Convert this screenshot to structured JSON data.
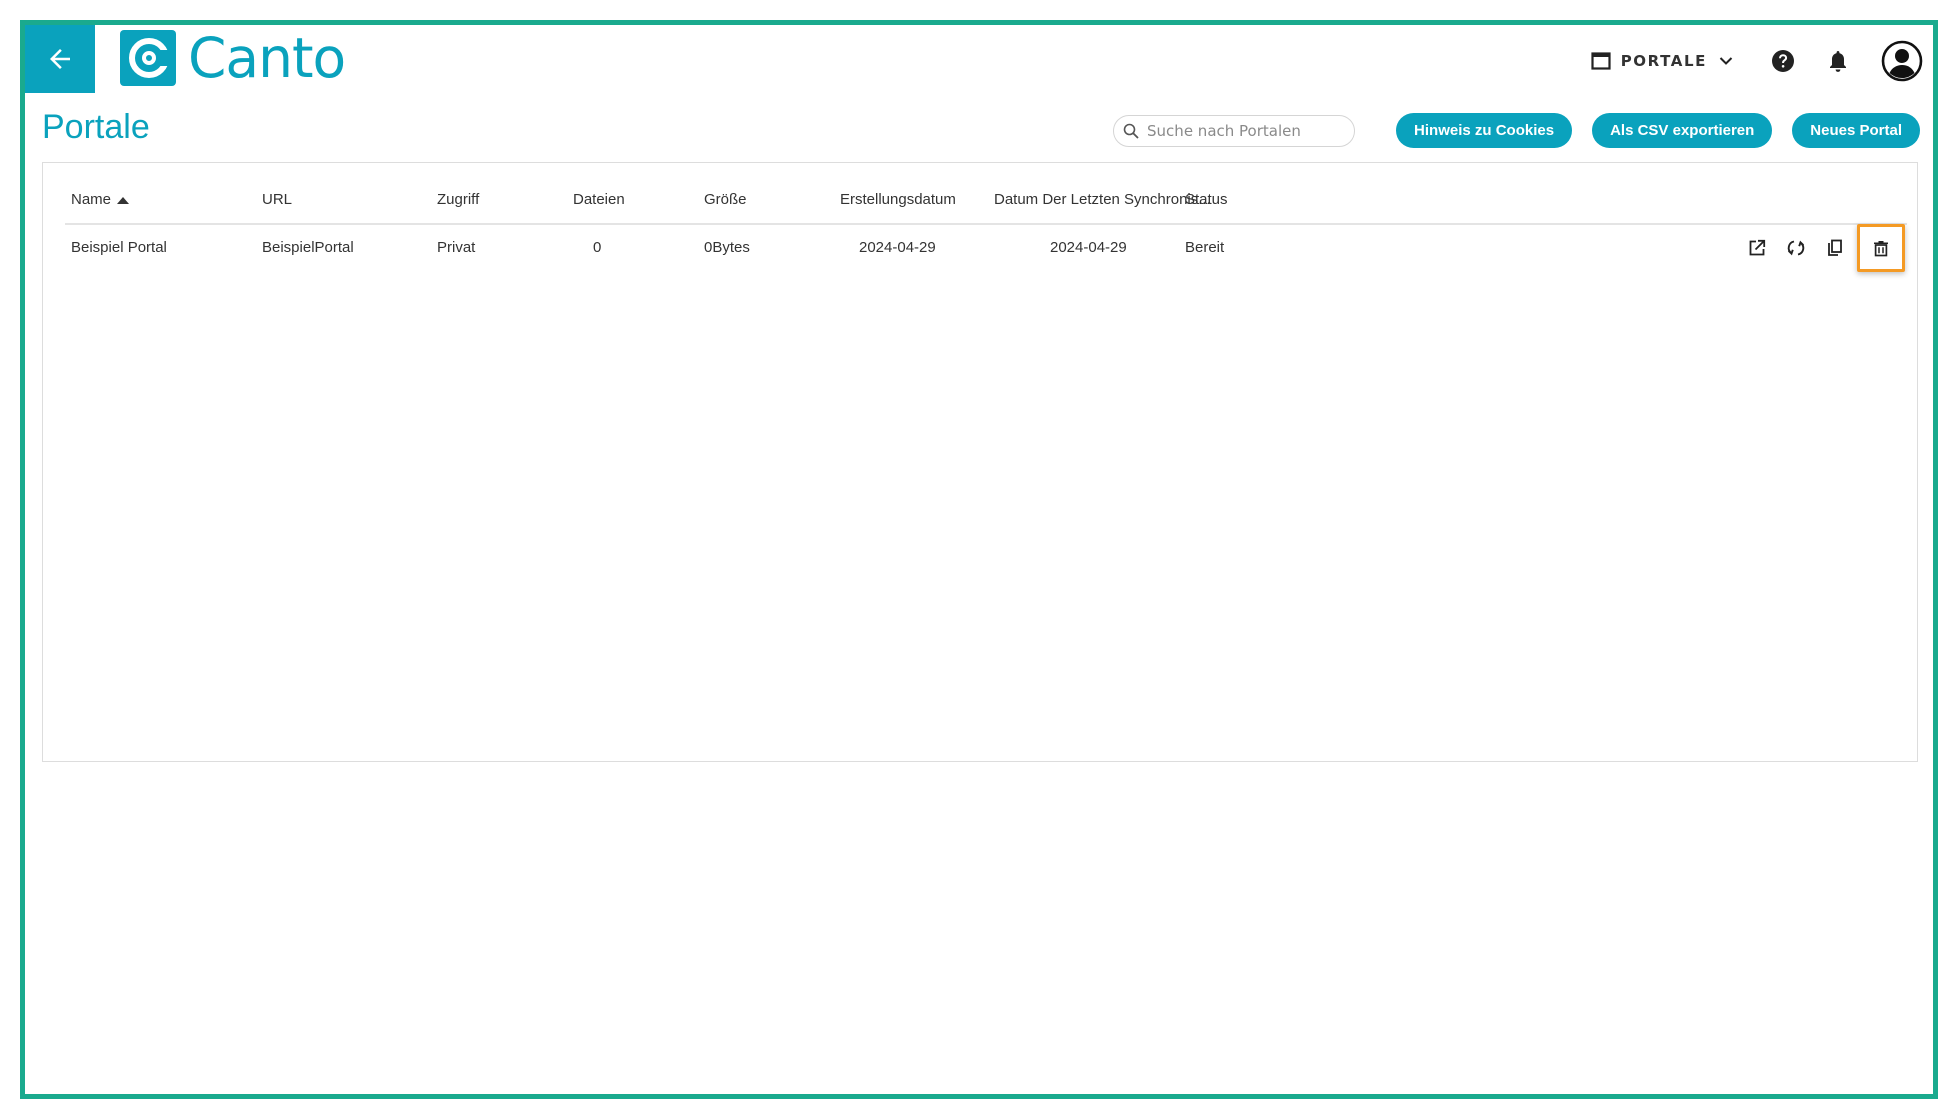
{
  "app": {
    "logo_text": "Canto",
    "accent_color": "#0aa2bd",
    "frame_color": "#1aaa8e",
    "highlight_color": "#f49a24"
  },
  "topnav": {
    "portal_switch_label": "PORTALE",
    "icons": [
      "window-icon",
      "chevron-down-icon",
      "help-icon",
      "bell-icon",
      "user-avatar-icon"
    ]
  },
  "page": {
    "title": "Portale"
  },
  "search": {
    "placeholder": "Suche nach Portalen",
    "value": ""
  },
  "buttons": {
    "cookies": "Hinweis zu Cookies",
    "export_csv": "Als CSV exportieren",
    "new_portal": "Neues Portal"
  },
  "table": {
    "columns": [
      "Name",
      "URL",
      "Zugriff",
      "Dateien",
      "Größe",
      "Erstellungsdatum",
      "Datum Der Letzten Synchronis...",
      "Status"
    ],
    "sort": {
      "column": "Name",
      "direction": "ascending"
    },
    "rows": [
      {
        "name": "Beispiel Portal",
        "url": "BeispielPortal",
        "access": "Privat",
        "files": "0",
        "size": "0Bytes",
        "created": "2024-04-29",
        "last_sync": "2024-04-29",
        "status": "Bereit",
        "actions": [
          "open-external-icon",
          "sync-icon",
          "copy-icon",
          "trash-icon"
        ]
      }
    ]
  }
}
